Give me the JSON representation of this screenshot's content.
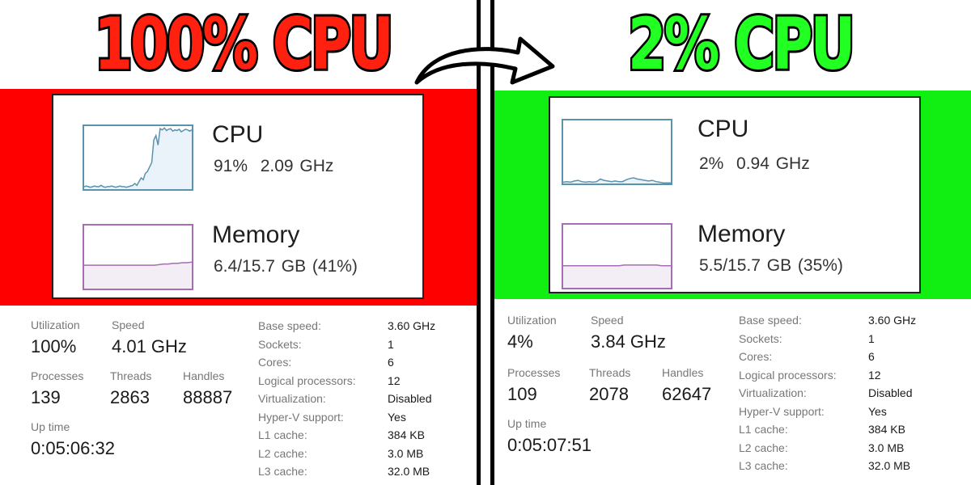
{
  "headlines": {
    "before": "100% CPU",
    "after": "2% CPU",
    "before_color": "#ff2010",
    "after_color": "#22ff22"
  },
  "arrow_icon": "curved-right-arrow",
  "panels": [
    {
      "id": "before",
      "band_color": "#ff0000",
      "cpu": {
        "title": "CPU",
        "summary": "91%  2.09 GHz",
        "graph_series": [
          4,
          5,
          4,
          3,
          4,
          5,
          4,
          4,
          6,
          4,
          3,
          4,
          4,
          5,
          4,
          3,
          4,
          5,
          4,
          4,
          3,
          4,
          5,
          6,
          9,
          6,
          12,
          18,
          15,
          25,
          28,
          35,
          42,
          78,
          85,
          70,
          96,
          94,
          97,
          93,
          95,
          96,
          92,
          94,
          93,
          95,
          91,
          93,
          95,
          94,
          92,
          94
        ],
        "graph_color": "#5b93ad"
      },
      "memory": {
        "title": "Memory",
        "summary": "6.4/15.7 GB (41%)",
        "graph_series": [
          37,
          37,
          37,
          37,
          37,
          37,
          37,
          37,
          37,
          37,
          37,
          37,
          37,
          37,
          37,
          37,
          38,
          39,
          39,
          40,
          40,
          41,
          41,
          42
        ],
        "graph_color": "#a56eb3"
      },
      "stats": {
        "utilization_label": "Utilization",
        "utilization": "100%",
        "speed_label": "Speed",
        "speed": "4.01 GHz",
        "processes_label": "Processes",
        "processes": "139",
        "threads_label": "Threads",
        "threads": "2863",
        "handles_label": "Handles",
        "handles": "88887",
        "uptime_label": "Up time",
        "uptime": "0:05:06:32"
      },
      "specs": [
        {
          "label": "Base speed:",
          "value": "3.60 GHz"
        },
        {
          "label": "Sockets:",
          "value": "1"
        },
        {
          "label": "Cores:",
          "value": "6"
        },
        {
          "label": "Logical processors:",
          "value": "12"
        },
        {
          "label": "Virtualization:",
          "value": "Disabled"
        },
        {
          "label": "Hyper-V support:",
          "value": "Yes"
        },
        {
          "label": "L1 cache:",
          "value": "384 KB"
        },
        {
          "label": "L2 cache:",
          "value": "3.0 MB"
        },
        {
          "label": "L3 cache:",
          "value": "32.0 MB"
        }
      ]
    },
    {
      "id": "after",
      "band_color": "#11ee11",
      "cpu": {
        "title": "CPU",
        "summary": "2%  0.94 GHz",
        "graph_series": [
          2,
          3,
          2,
          4,
          5,
          3,
          2,
          3,
          2,
          3,
          7,
          5,
          4,
          3,
          4,
          3,
          3,
          6,
          8,
          9,
          7,
          6,
          5,
          4,
          5,
          3,
          2,
          1,
          1,
          1
        ],
        "graph_color": "#5b93ad"
      },
      "memory": {
        "title": "Memory",
        "summary": "5.5/15.7 GB (35%)",
        "graph_series": [
          35,
          35,
          35,
          35,
          35,
          35,
          35,
          35,
          35,
          35,
          35,
          35,
          35,
          36,
          36,
          36,
          36,
          36,
          36,
          36,
          36,
          35,
          35,
          35
        ],
        "graph_color": "#a56eb3"
      },
      "stats": {
        "utilization_label": "Utilization",
        "utilization": "4%",
        "speed_label": "Speed",
        "speed": "3.84 GHz",
        "processes_label": "Processes",
        "processes": "109",
        "threads_label": "Threads",
        "threads": "2078",
        "handles_label": "Handles",
        "handles": "62647",
        "uptime_label": "Up time",
        "uptime": "0:05:07:51"
      },
      "specs": [
        {
          "label": "Base speed:",
          "value": "3.60 GHz"
        },
        {
          "label": "Sockets:",
          "value": "1"
        },
        {
          "label": "Cores:",
          "value": "6"
        },
        {
          "label": "Logical processors:",
          "value": "12"
        },
        {
          "label": "Virtualization:",
          "value": "Disabled"
        },
        {
          "label": "Hyper-V support:",
          "value": "Yes"
        },
        {
          "label": "L1 cache:",
          "value": "384 KB"
        },
        {
          "label": "L2 cache:",
          "value": "3.0 MB"
        },
        {
          "label": "L3 cache:",
          "value": "32.0 MB"
        }
      ]
    }
  ]
}
